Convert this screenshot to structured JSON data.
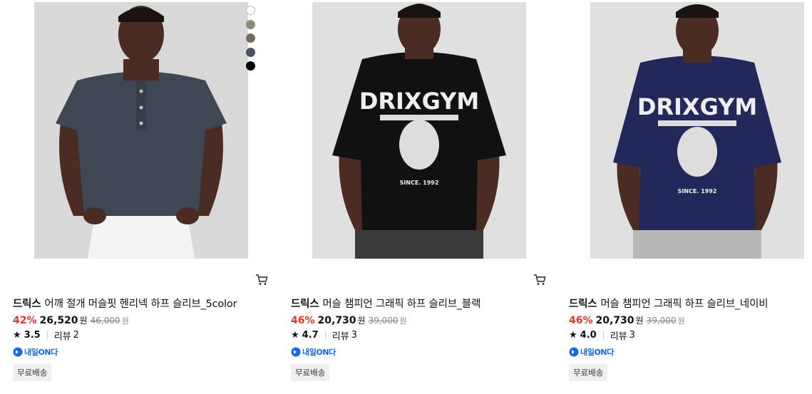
{
  "products": [
    {
      "brand": "드릭스",
      "name": "어깨 절개 머슬핏 헨리넥 하프 슬리브_5color",
      "discount": "42%",
      "price": "26,520",
      "currency": "원",
      "original_price": "46,000",
      "rating": "3.5",
      "review_label": "리뷰",
      "review_count": "2",
      "delivery_badge": "내일ON다",
      "free_shipping": "무료배송",
      "image": "model-henley-navy-gray",
      "swatches": [
        "#ffffff",
        "#8b8b73",
        "#766b60",
        "#4a5264",
        "#000000"
      ]
    },
    {
      "brand": "드릭스",
      "name": "머슬 챔피언 그래픽 하프 슬리브_블랙",
      "discount": "46%",
      "price": "20,730",
      "currency": "원",
      "original_price": "39,000",
      "rating": "4.7",
      "review_label": "리뷰",
      "review_count": "3",
      "delivery_badge": "내일ON다",
      "free_shipping": "무료배송",
      "image": "model-graphic-tee-black",
      "graphic_text": "DRIXGYM",
      "graphic_sub": "SINCE. 1992"
    },
    {
      "brand": "드릭스",
      "name": "머슬 챔피언 그래픽 하프 슬리브_네이비",
      "discount": "46%",
      "price": "20,730",
      "currency": "원",
      "original_price": "39,000",
      "rating": "4.0",
      "review_label": "리뷰",
      "review_count": "3",
      "delivery_badge": "내일ON다",
      "free_shipping": "무료배송",
      "image": "model-graphic-tee-navy",
      "graphic_text": "DRIXGYM",
      "graphic_sub": "SINCE. 1992"
    }
  ],
  "colors": {
    "discount": "#e8332e",
    "badge_blue": "#1467e8",
    "tee_black": "#111111",
    "tee_navy": "#22295a",
    "henley": "#3f4654"
  },
  "icons": {
    "cart": "cart-icon",
    "star": "star-icon",
    "badge": "delivery-truck-icon"
  }
}
